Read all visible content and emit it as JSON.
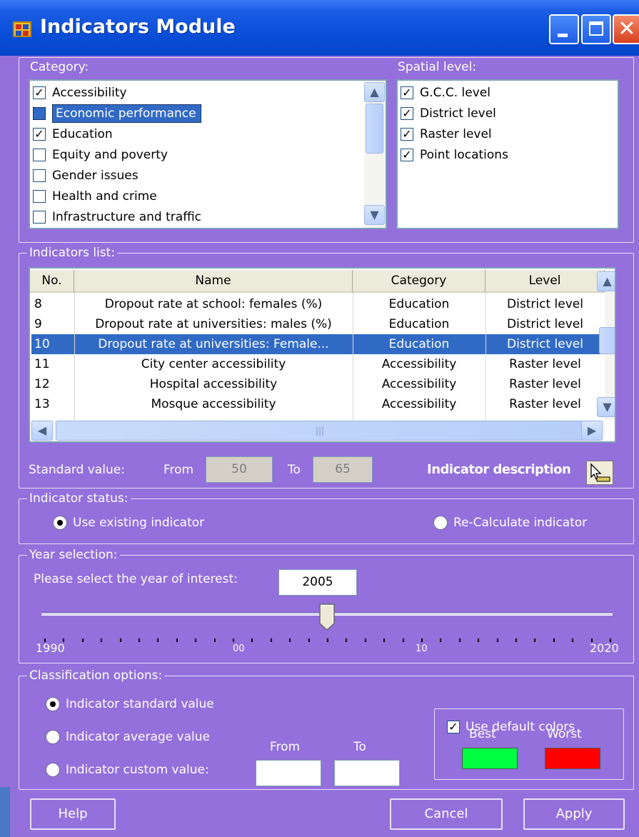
{
  "window": {
    "title": "Indicators Module"
  },
  "category": {
    "label": "Category:",
    "items": [
      {
        "label": "Accessibility",
        "checked": true,
        "selected": false
      },
      {
        "label": "Economic performance",
        "checked": false,
        "selected": true
      },
      {
        "label": "Education",
        "checked": true,
        "selected": false
      },
      {
        "label": "Equity and poverty",
        "checked": false,
        "selected": false
      },
      {
        "label": "Gender issues",
        "checked": false,
        "selected": false
      },
      {
        "label": "Health and crime",
        "checked": false,
        "selected": false
      },
      {
        "label": "Infrastructure and traffic",
        "checked": false,
        "selected": false
      }
    ]
  },
  "spatial": {
    "label": "Spatial level:",
    "items": [
      {
        "label": "G.C.C. level",
        "checked": true
      },
      {
        "label": "District level",
        "checked": true
      },
      {
        "label": "Raster level",
        "checked": true
      },
      {
        "label": "Point locations",
        "checked": true
      }
    ]
  },
  "indicators": {
    "label": "Indicators list:",
    "columns": [
      "No.",
      "Name",
      "Category",
      "Level"
    ],
    "rows": [
      {
        "no": "8",
        "name": "Dropout rate at school: females (%)",
        "category": "Education",
        "level": "District level",
        "selected": false
      },
      {
        "no": "9",
        "name": "Dropout rate at universities: males (%)",
        "category": "Education",
        "level": "District level",
        "selected": false
      },
      {
        "no": "10",
        "name": "Dropout rate at universities: Female...",
        "category": "Education",
        "level": "District level",
        "selected": true
      },
      {
        "no": "11",
        "name": "City center accessibility",
        "category": "Accessibility",
        "level": "Raster level",
        "selected": false
      },
      {
        "no": "12",
        "name": "Hospital accessibility",
        "category": "Accessibility",
        "level": "Raster level",
        "selected": false
      },
      {
        "no": "13",
        "name": "Mosque accessibility",
        "category": "Accessibility",
        "level": "Raster level",
        "selected": false
      }
    ]
  },
  "standard": {
    "label": "Standard value:",
    "from_label": "From",
    "from_value": "50",
    "to_label": "To",
    "to_value": "65",
    "description_label": "Indicator description"
  },
  "status": {
    "label": "Indicator status:",
    "use_existing": "Use existing indicator",
    "recalculate": "Re-Calculate indicator",
    "selected": "use_existing"
  },
  "year": {
    "label": "Year selection:",
    "prompt": "Please select the year of interest:",
    "value": "2005",
    "min": 1990,
    "max": 2020,
    "current": 2005,
    "tick_labels": {
      "start": "1990",
      "mid1": "00",
      "mid2": "10",
      "end": "2020"
    }
  },
  "classification": {
    "label": "Classification options:",
    "standard": "Indicator standard value",
    "average": "Indicator average value",
    "custom": "Indicator custom value:",
    "selected": "standard",
    "from_label": "From",
    "to_label": "To",
    "from_value": "",
    "to_value": "",
    "default_colors_label": "Use default colors",
    "default_colors_checked": true,
    "best_label": "Best",
    "worst_label": "Worst",
    "best_color": "#00ff40",
    "worst_color": "#ff0000"
  },
  "buttons": {
    "help": "Help",
    "cancel": "Cancel",
    "apply": "Apply"
  },
  "colors": {
    "window_bg": "#9370db",
    "titlebar": "#0a4fd9",
    "selection": "#316ac5"
  }
}
